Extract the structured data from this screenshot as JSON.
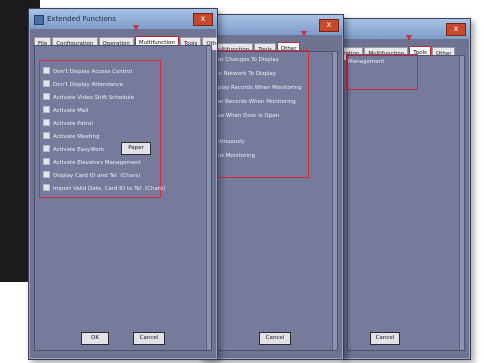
{
  "dialog_title": "Extended Functions",
  "close_glyph": "x",
  "tabs": [
    "File",
    "Configuration",
    "Operation",
    "Multifunction",
    "Tools",
    "Other"
  ],
  "front": {
    "active_tab": "Multifunction",
    "options": [
      "Don't Display Access Control",
      "Don't Display Attendance",
      "Activate Video Shift Schedule",
      "Activate Mail",
      "Activate Patrol",
      "Activate Meeting",
      "Activate EasyWork",
      "Activate Elevators Management",
      "Display Card ID and Tel. (Chars)",
      "Import Valid Date, Card ID to Tel. (Chars)"
    ],
    "inline_button": "Paper",
    "ok_label": "OK",
    "cancel_label": "Cancel"
  },
  "middle": {
    "active_tab": "Other",
    "options": [
      "Allow Changes To Display",
      "Auto Network To Display",
      "Display Records When Monitoring",
      "Clear Records When Monitoring",
      "Close When Door is Open",
      "Continuously",
      "Show Monitoring"
    ],
    "cancel_label": "Cancel"
  },
  "back": {
    "active_tab": "Tools",
    "options": [
      "Management"
    ],
    "cancel_label": "Cancel"
  },
  "colors": {
    "dialog_body": "#6e7392",
    "title_bar": "#7d9cc9",
    "highlight": "#d42a3e",
    "backdrop": "#1c1c1c"
  }
}
